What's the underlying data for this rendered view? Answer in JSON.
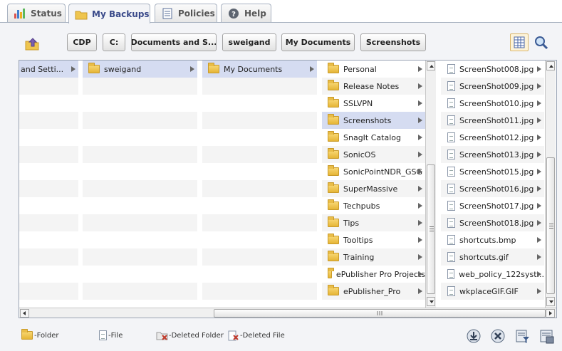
{
  "tabs": [
    {
      "label": "Status",
      "icon": "bar-chart-icon"
    },
    {
      "label": "My Backups",
      "icon": "folder-icon",
      "active": true
    },
    {
      "label": "Policies",
      "icon": "document-icon"
    },
    {
      "label": "Help",
      "icon": "help-icon"
    }
  ],
  "toolbar": {
    "up_icon": "up-folder-icon",
    "breadcrumbs": [
      "CDP",
      "C:",
      "Documents and S...",
      "sweigand",
      "My Documents",
      "Screenshots"
    ],
    "view_icon": "column-view-icon",
    "search_icon": "magnifier-icon"
  },
  "columns": {
    "col1": [
      "and Setti..."
    ],
    "col2": [
      "sweigand"
    ],
    "col3": [
      "My Documents"
    ],
    "col4": [
      "Personal",
      "Release Notes",
      "SSLVPN",
      "Screenshots",
      "SnagIt Catalog",
      "SonicOS",
      "SonicPointNDR_GSG",
      "SuperMassive",
      "Techpubs",
      "Tips",
      "Tooltips",
      "Training",
      "ePublisher Pro Projects",
      "ePublisher_Pro"
    ],
    "col4_selected": "Screenshots",
    "col5": [
      "ScreenShot008.jpg",
      "ScreenShot009.jpg",
      "ScreenShot010.jpg",
      "ScreenShot011.jpg",
      "ScreenShot012.jpg",
      "ScreenShot013.jpg",
      "ScreenShot015.jpg",
      "ScreenShot016.jpg",
      "ScreenShot017.jpg",
      "ScreenShot018.jpg",
      "shortcuts.bmp",
      "shortcuts.gif",
      "web_policy_122syst...",
      "wkplaceGIF.GIF"
    ]
  },
  "legend": {
    "folder": "-Folder",
    "file": "-File",
    "deleted_folder": "-Deleted Folder",
    "deleted_file": "-Deleted File"
  },
  "actions": [
    "download-icon",
    "delete-icon",
    "filter-icon",
    "restore-icon"
  ],
  "colors": {
    "accent": "#3a4a8a",
    "selection": "#d5dcf1",
    "folder": "#e5b536"
  }
}
